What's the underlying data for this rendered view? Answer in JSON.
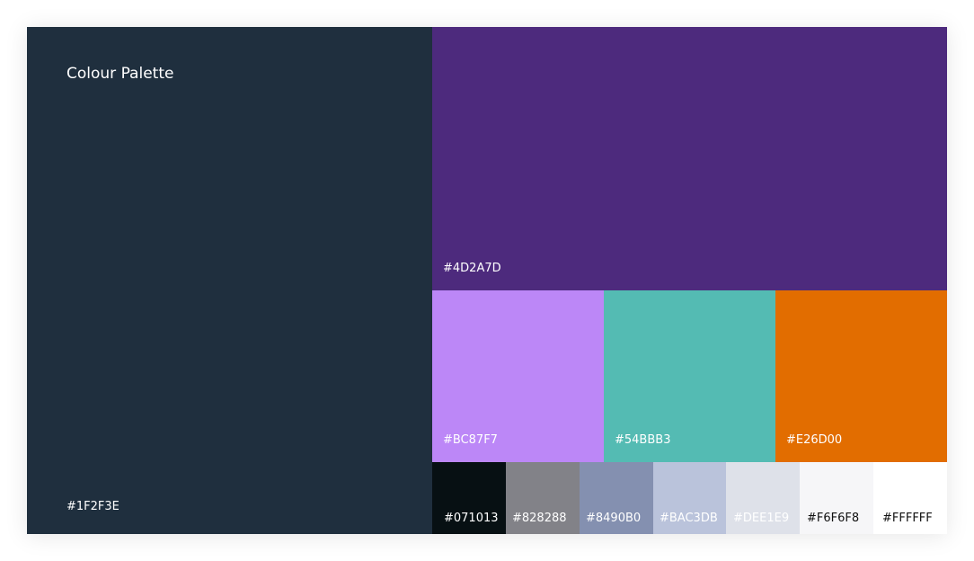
{
  "palette": {
    "title": "Colour Palette",
    "primary": {
      "hex": "#1F2F3E",
      "color": "#1F2F3E"
    },
    "accent_main": {
      "hex": "#4D2A7D",
      "color": "#4D2A7D"
    },
    "accents": [
      {
        "hex": "#BC87F7",
        "color": "#BC87F7"
      },
      {
        "hex": "#54BBB3",
        "color": "#54BBB3"
      },
      {
        "hex": "#E26D00",
        "color": "#E26D00"
      }
    ],
    "neutrals": [
      {
        "hex": "#071013",
        "color": "#071013",
        "text_color": "#ffffff"
      },
      {
        "hex": "#828288",
        "color": "#828288",
        "text_color": "#ffffff"
      },
      {
        "hex": "#8490B0",
        "color": "#8490B0",
        "text_color": "#ffffff"
      },
      {
        "hex": "#BAC3DB",
        "color": "#BAC3DB",
        "text_color": "#ffffff"
      },
      {
        "hex": "#DEE1E9",
        "color": "#DEE1E9",
        "text_color": "#ffffff"
      },
      {
        "hex": "#F6F6F8",
        "color": "#F6F6F8",
        "text_color": "#111111"
      },
      {
        "hex": "#FFFFFF",
        "color": "#FFFFFF",
        "text_color": "#111111"
      }
    ]
  }
}
